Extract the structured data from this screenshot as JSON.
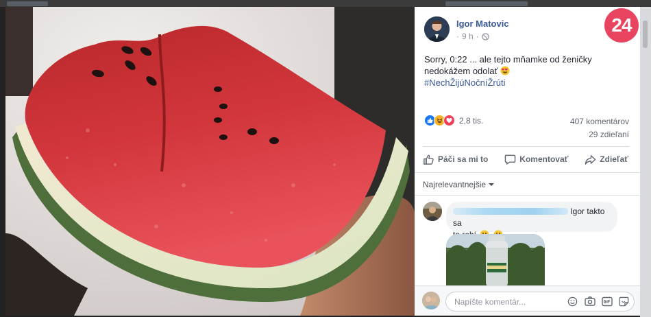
{
  "browser": {
    "blurred_tab_hint": ""
  },
  "post": {
    "author": "Igor Matovic",
    "time": "9 h",
    "separator": "·",
    "brand_badge": "24",
    "text_line1": "Sorry, 0:22 ... ale tejto mňamke od ženičky",
    "text_line2": "nedokážem odolať",
    "hashtag": "#NechŽijúNočníŽrúti",
    "reaction_count": "2,8 tis.",
    "comments_count": "407 komentárov",
    "shares_count": "29 zdieľaní"
  },
  "actions": {
    "like": "Páči sa mi to",
    "comment": "Komentovať",
    "share": "Zdieľať"
  },
  "sort": {
    "label": "Najrelevantnejšie"
  },
  "comment": {
    "text_after_redaction": "Igor takto sa",
    "text_line2": "to robí"
  },
  "composer": {
    "placeholder": "Napíšte komentár..."
  },
  "icons": {
    "like": "thumbs-up-icon",
    "haha": "laughing-face-icon",
    "love": "heart-icon",
    "globe": "globe-icon",
    "emoji": "smiley-icon",
    "camera": "camera-icon",
    "gif": "gif-icon",
    "sticker": "sticker-icon"
  },
  "colors": {
    "link_blue": "#385898",
    "brand_pink": "#e9445f",
    "like_blue": "#1877f2",
    "love_red": "#f33e58",
    "haha_yellow": "#f7b125"
  }
}
